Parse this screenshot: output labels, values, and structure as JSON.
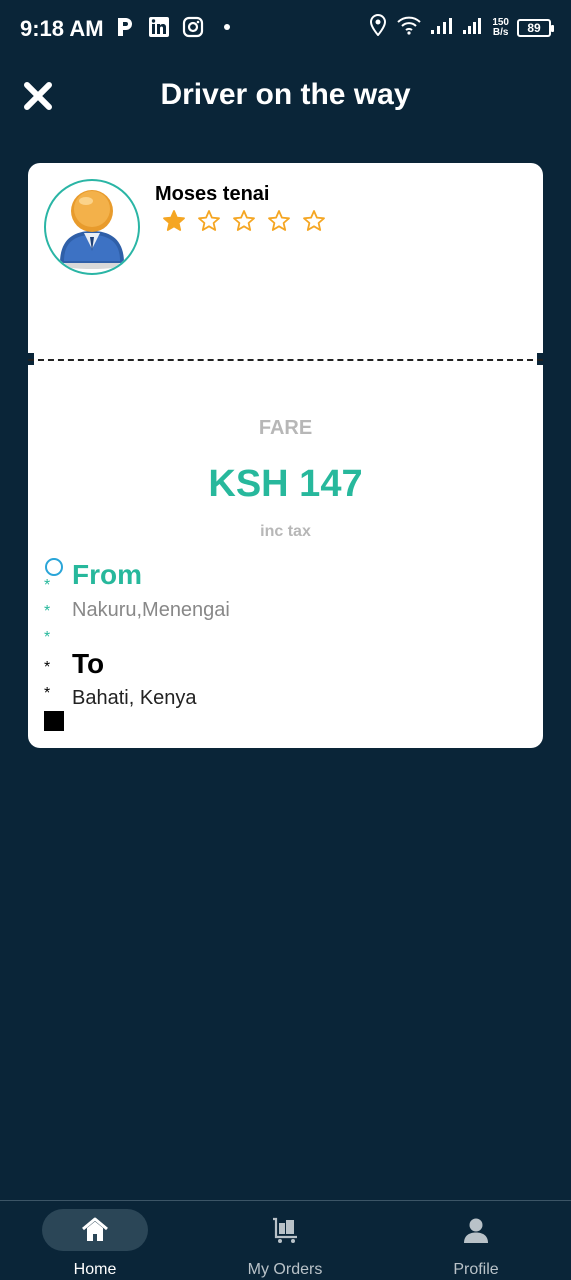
{
  "status_bar": {
    "time": "9:18 AM",
    "left_icons": [
      "parking-icon",
      "linkedin-icon",
      "instagram-icon",
      "dot-icon"
    ],
    "net_speed_value": "150",
    "net_speed_unit": "B/s",
    "battery": "89"
  },
  "header": {
    "title": "Driver on the way",
    "close_icon": "close-icon"
  },
  "driver": {
    "name": "Moses tenai",
    "rating": 1,
    "rating_max": 5
  },
  "fare": {
    "label": "FARE",
    "amount": "KSH 147",
    "tax_note": "inc tax"
  },
  "route": {
    "from_label": "From",
    "from_address": "Nakuru,Menengai",
    "to_label": "To",
    "to_address": "Bahati, Kenya",
    "marker": "*"
  },
  "nav": {
    "items": [
      {
        "label": "Home",
        "icon": "home-icon",
        "active": true
      },
      {
        "label": "My Orders",
        "icon": "orders-cart-icon",
        "active": false
      },
      {
        "label": "Profile",
        "icon": "profile-icon",
        "active": false
      }
    ]
  },
  "colors": {
    "background": "#0a2538",
    "accent": "#27b89c",
    "star": "#f5a623",
    "card": "#ffffff"
  }
}
